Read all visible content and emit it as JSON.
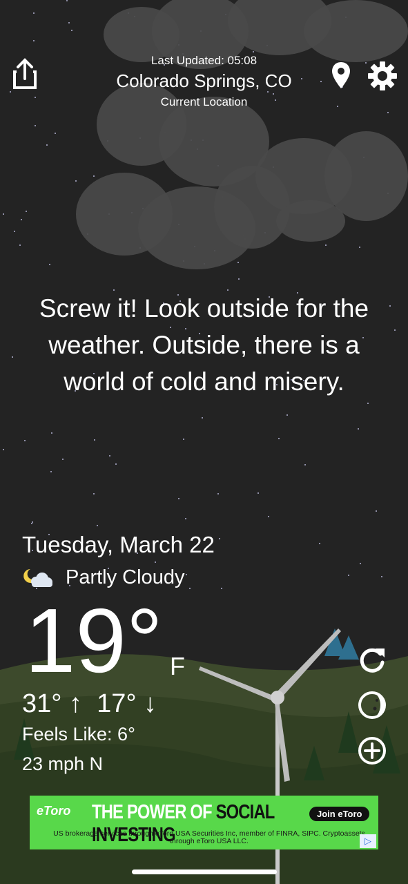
{
  "header": {
    "last_updated": "Last Updated: 05:08",
    "city": "Colorado Springs, CO",
    "location_label": "Current Location"
  },
  "icons": {
    "share": "share-icon",
    "location": "location-pin-icon",
    "settings": "gear-icon",
    "condition": "partly-cloudy-night-icon",
    "refresh": "refresh-icon",
    "moon": "moon-icon",
    "add": "add-icon"
  },
  "quote": "Screw it! Look outside for the weather. Outside, there is a world of cold and misery.",
  "weather": {
    "date": "Tuesday, March 22",
    "condition": "Partly Cloudy",
    "temperature": "19°",
    "unit": "F",
    "hi_lo": "31° ↑  17° ↓",
    "feels_like": "Feels Like: 6°",
    "wind": "23 mph N"
  },
  "ad": {
    "logo": "eToro",
    "headline_prefix": "THE POWER OF",
    "headline_emphasis": "SOCIAL INVESTING",
    "button": "Join eToro",
    "fine_print": "US brokerage services through eToro USA Securities Inc, member of FINRA, SIPC. Cryptoassets through eToro USA LLC.",
    "badge": "▷"
  },
  "colors": {
    "sky": "#232323",
    "cloud": "#4a4a4a",
    "ad_background": "#58d84a"
  }
}
